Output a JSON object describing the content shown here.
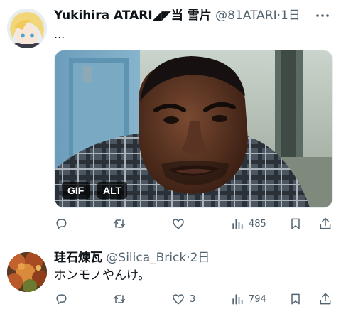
{
  "tweets": [
    {
      "display_name": "Yukihira ATARI◢◤当 雪片",
      "handle": "@81ATARI",
      "dot": "·",
      "time": "1日",
      "text": "...",
      "media": {
        "badges": [
          "GIF",
          "ALT"
        ]
      },
      "actions": {
        "reply": "",
        "retweet": "",
        "like": "",
        "views": "485"
      }
    },
    {
      "display_name": "珪石煉瓦",
      "handle": "@Silica_Brick",
      "dot": "·",
      "time": "2日",
      "text": "ホンモノやんけ。",
      "actions": {
        "reply": "",
        "retweet": "",
        "like": "3",
        "views": "794"
      }
    }
  ],
  "icons": {
    "more": "more-horizontal-icon",
    "reply": "reply-icon",
    "retweet": "retweet-icon",
    "like": "heart-icon",
    "views": "analytics-icon",
    "bookmark": "bookmark-icon",
    "share": "share-icon"
  },
  "colors": {
    "text": "#0f1419",
    "secondary": "#536471",
    "divider": "#eff3f4"
  }
}
